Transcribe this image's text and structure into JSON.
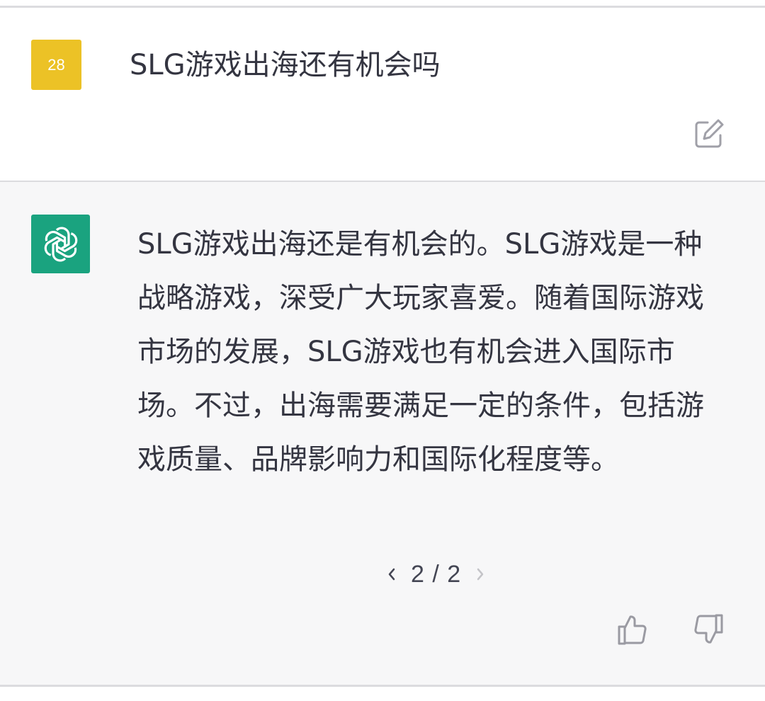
{
  "user_message": {
    "avatar_label": "28",
    "text": "SLG游戏出海还有机会吗",
    "edit_icon": "edit-icon"
  },
  "assistant_message": {
    "avatar_icon": "openai-logo-icon",
    "text": "SLG游戏出海还是有机会的。SLG游戏是一种战略游戏，深受广大玩家喜爱。随着国际游戏市场的发展，SLG游戏也有机会进入国际市场。不过，出海需要满足一定的条件，包括游戏质量、品牌影响力和国际化程度等。",
    "pager": {
      "label": "2 / 2",
      "prev_icon": "chevron-left-icon",
      "next_icon": "chevron-right-icon"
    },
    "feedback": {
      "up_icon": "thumbs-up-icon",
      "down_icon": "thumbs-down-icon"
    }
  },
  "colors": {
    "user_avatar_bg": "#ecc226",
    "bot_avatar_bg": "#1aa37f",
    "assistant_bg": "#f7f7f8",
    "text": "#343541"
  }
}
